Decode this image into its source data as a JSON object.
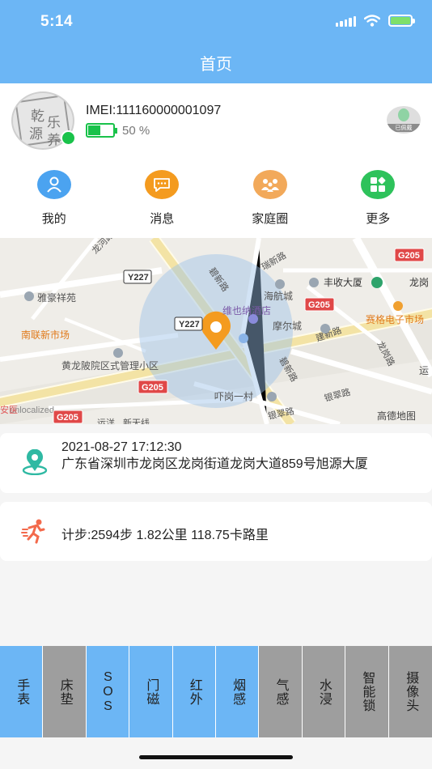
{
  "status_bar": {
    "time": "5:14"
  },
  "header": {
    "title": "首页"
  },
  "device": {
    "avatar_text": [
      "乾",
      "乐",
      "源",
      "养"
    ],
    "imei": "IMEI:111160000001097",
    "battery_percent_text": "50 %",
    "battery_level": 0.5,
    "worn_status": "已佩戴"
  },
  "shortcuts": [
    {
      "label": "我的",
      "icon": "person-icon",
      "color": "#4ba3f0"
    },
    {
      "label": "消息",
      "icon": "chat-icon",
      "color": "#f49b1f"
    },
    {
      "label": "家庭圈",
      "icon": "family-icon",
      "color": "#f2a95a"
    },
    {
      "label": "更多",
      "icon": "grid-icon",
      "color": "#2ec25b"
    }
  ],
  "map": {
    "labels": {
      "longhe": "龙河路",
      "y227_a": "Y227",
      "y227_b": "Y227",
      "ruixin": "瑞新路",
      "bixin_a": "碧新路",
      "bixin_b": "碧新路",
      "haihang": "海航城",
      "fengshou": "丰收大厦",
      "longgang_partial": "龙岗",
      "g205_a": "G205",
      "g205_b": "G205",
      "g205_c": "G205",
      "g205_d": "G205",
      "yahao": "雅豪祥苑",
      "nanlian": "南联新市场",
      "hotel": "维也纳酒店",
      "moer": "摩尔城",
      "saige": "赛格电子市场",
      "jianxin": "建新路",
      "longgang_rd": "龙岗路",
      "yun": "运",
      "huanglong": "黄龙陂院区式管理小区",
      "yigang": "吓岗一村",
      "yincui_a": "银翠路",
      "yincui_b": "银翠路",
      "unlocalized": "unlocalized",
      "an": "安医",
      "yunyang": "运洋",
      "xingyun": "新天线",
      "gaode": "高德地图"
    }
  },
  "location": {
    "time": "2021-08-27 17:12:30",
    "address": "广东省深圳市龙岗区龙岗街道龙岗大道859号旭源大厦"
  },
  "steps": {
    "text": "计步:2594步 1.82公里 118.75卡路里"
  },
  "tabs": [
    {
      "label": "手表",
      "active": true
    },
    {
      "label": "床垫",
      "active": false
    },
    {
      "label": "SOS",
      "active": true
    },
    {
      "label": "门磁",
      "active": true
    },
    {
      "label": "红外",
      "active": true
    },
    {
      "label": "烟感",
      "active": true
    },
    {
      "label": "气感",
      "active": false
    },
    {
      "label": "水浸",
      "active": false
    },
    {
      "label": "智能锁",
      "active": false
    },
    {
      "label": "摄像头",
      "active": false
    }
  ],
  "colors": {
    "accent": "#6cb6f5",
    "online": "#19c24a",
    "pin": "#f49b1f",
    "inactive_tab": "#9e9e9e"
  }
}
